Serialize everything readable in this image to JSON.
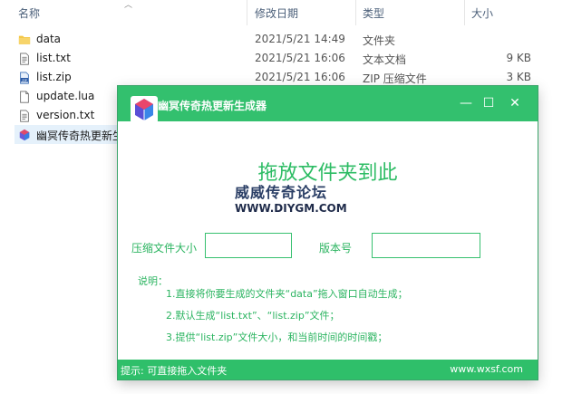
{
  "explorer": {
    "columns": {
      "name": "名称",
      "date": "修改日期",
      "type": "类型",
      "size": "大小"
    },
    "files": [
      {
        "name": "data",
        "date": "2021/5/21 14:49",
        "type": "文件夹",
        "size": "",
        "icon": "folder-icon"
      },
      {
        "name": "list.txt",
        "date": "2021/5/21 16:06",
        "type": "文本文档",
        "size": "9 KB",
        "icon": "text-file-icon"
      },
      {
        "name": "list.zip",
        "date": "2021/5/21 16:06",
        "type": "ZIP 压缩文件",
        "size": "3 KB",
        "icon": "zip-file-icon"
      },
      {
        "name": "update.lua",
        "date": "",
        "type": "",
        "size": "",
        "icon": "file-icon"
      },
      {
        "name": "version.txt",
        "date": "",
        "type": "",
        "size": "",
        "icon": "text-file-icon"
      },
      {
        "name": "幽冥传奇热更新生",
        "date": "",
        "type": "",
        "size": "",
        "icon": "app-icon"
      }
    ]
  },
  "app": {
    "title": "幽冥传奇热更新生成器",
    "drop_title": "拖放文件夹到此",
    "watermark_cn": "威威传奇论坛",
    "watermark_url": "WWW.DIYGM.COM",
    "size_label": "压缩文件大小",
    "size_value": "",
    "version_label": "版本号",
    "version_value": "",
    "desc_title": "说明：",
    "desc_lines": [
      "1.直接将你要生成的文件夹“data”拖入窗口自动生成；",
      "2.默认生成“list.txt”、“list.zip”文件；",
      "3.提供“list.zip”文件大小，和当前时间的时间戳；"
    ],
    "status_left": "提示:   可直接拖入文件夹",
    "status_right": "www.wxsf.com",
    "controls": {
      "minimize": "—",
      "maximize": "☐",
      "close": "✕"
    }
  },
  "colors": {
    "accent": "#33c06e",
    "folder": "#f4c542"
  }
}
